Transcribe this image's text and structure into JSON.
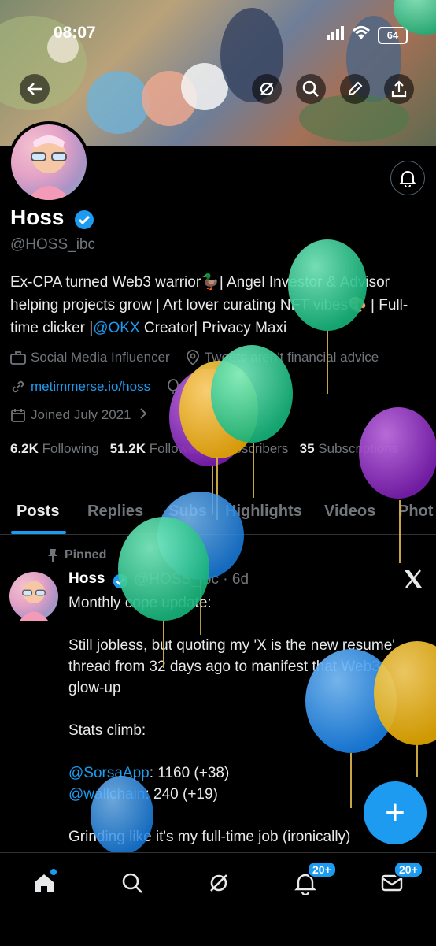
{
  "status_bar": {
    "time": "08:07",
    "battery": "64"
  },
  "profile": {
    "name": "Hoss",
    "handle": "@HOSS_ibc",
    "bio_before_mention": "Ex-CPA turned Web3 warrior🦆| Angel Investor & Advisor helping projects grow | Art lover curating NFT vibes🎨 | Full-time clicker |",
    "bio_mention": "@OKX",
    "bio_after_mention": " Creator| Privacy Maxi",
    "category": "Social Media Influencer",
    "location": "Tweets aren't financial advice",
    "website": "metimmerse.io/hoss",
    "birthday": "Birthday!",
    "joined": "Joined July 2021"
  },
  "stats": {
    "following_count": "6.2K",
    "following_label": "Following",
    "followers_count": "51.2K",
    "followers_label": "Followers",
    "subscribers_label": "Subscribers",
    "subscriptions_count": "35",
    "subscriptions_label": "Subscriptions"
  },
  "tabs": [
    "Posts",
    "Replies",
    "Subs",
    "Highlights",
    "Videos",
    "Phot"
  ],
  "post": {
    "pinned_label": "Pinned",
    "author": "Hoss",
    "handle_time": "@HOSS_ibc · 6d",
    "line1": "Monthly cope update:",
    "line2": "Still jobless, but quoting my 'X is the new resume' thread from 32 days ago to manifest that Web3 glow-up",
    "line3": "Stats climb:",
    "mention1": "@SorsaApp",
    "stat1": ": 1160 (+38)",
    "mention2": "@wallchain",
    "stat2": ": 240 (+19)",
    "line4": "Grinding like it's my full-time job (ironically)"
  },
  "nav": {
    "notifications_badge": "20+",
    "messages_badge": "20+"
  },
  "fab_label": "+"
}
